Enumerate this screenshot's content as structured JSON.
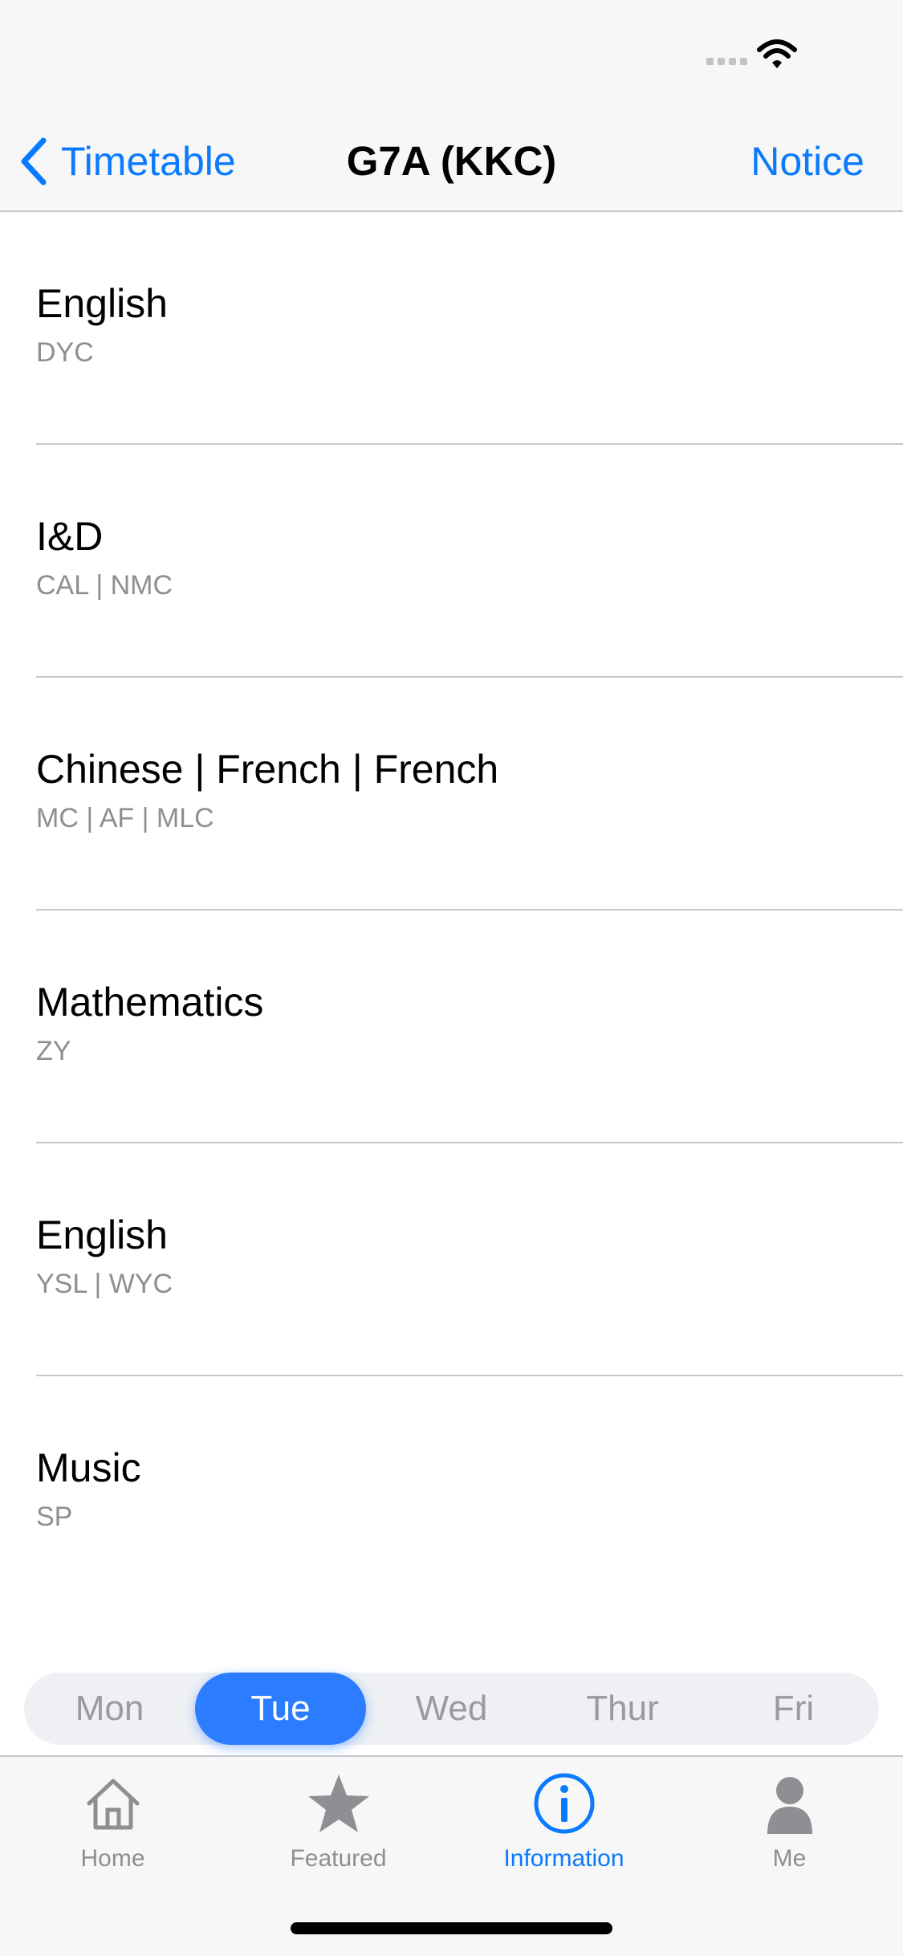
{
  "colors": {
    "accent": "#0a7aff",
    "active_day": "#2c7cff",
    "secondary_text": "#8e8e93"
  },
  "nav": {
    "back_label": "Timetable",
    "title": "G7A (KKC)",
    "right_button": "Notice"
  },
  "lessons": [
    {
      "subject": "English",
      "teachers": "DYC"
    },
    {
      "subject": "I&D",
      "teachers": "CAL | NMC"
    },
    {
      "subject": "Chinese | French | French",
      "teachers": "MC | AF | MLC"
    },
    {
      "subject": "Mathematics",
      "teachers": "ZY"
    },
    {
      "subject": "English",
      "teachers": "YSL | WYC"
    },
    {
      "subject": "Music",
      "teachers": "SP"
    }
  ],
  "days": [
    "Mon",
    "Tue",
    "Wed",
    "Thur",
    "Fri"
  ],
  "selected_day": "Tue",
  "tabs": [
    {
      "label": "Home",
      "icon": "house-icon"
    },
    {
      "label": "Featured",
      "icon": "star-icon"
    },
    {
      "label": "Information",
      "icon": "info-icon"
    },
    {
      "label": "Me",
      "icon": "person-icon"
    }
  ],
  "selected_tab": "Information"
}
